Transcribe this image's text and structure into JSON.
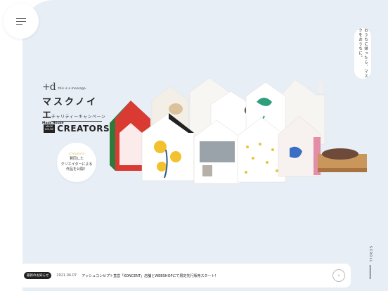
{
  "colors": {
    "background_panel": "#e8eef6",
    "accent_script": "#e8b84d"
  },
  "logo": {
    "mark": "+d",
    "message": "this is a message.",
    "title": "マスクノイエ",
    "subtitle": "Mask House"
  },
  "campaign": {
    "label": "チャリティーキャンペーン",
    "box": "MASK HOUSE",
    "word": "CREATORS"
  },
  "cta": {
    "script": "Creators",
    "line1": "賛同した",
    "line2": "クリエイターによる",
    "line3": "作品を公開！"
  },
  "vertical_copy": "おうちに帰ったら、マスクをおうちに。",
  "scroll_label": "SCROLL",
  "news": {
    "badge": "最新のお知らせ",
    "date": "2021.04.07",
    "text": "アッシュコンセプト直営「KONCENT」店舗とWEBSHOPにて限定先行販売スタート！",
    "arrow": "›"
  },
  "icons": {
    "menu": "hamburger-icon",
    "arrow": "chevron-right-icon"
  }
}
